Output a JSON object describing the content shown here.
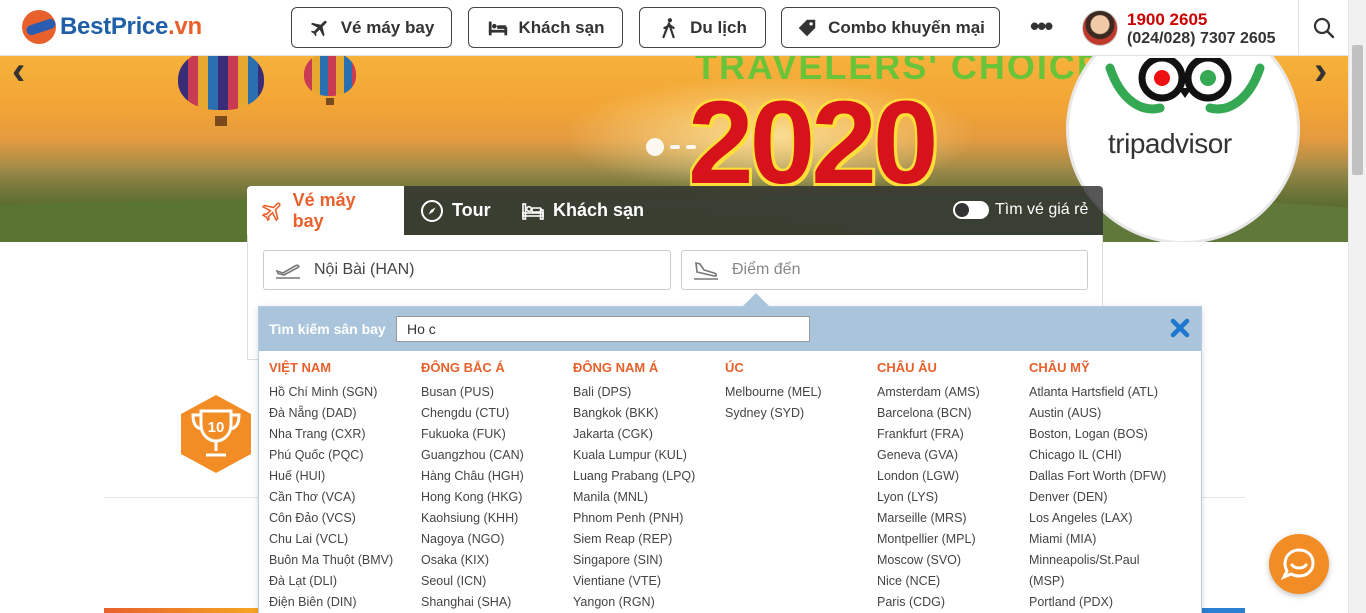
{
  "brand": {
    "name_main": "BestPrice",
    "name_tld": ".vn"
  },
  "nav": {
    "items": [
      {
        "label": "Vé máy bay",
        "icon": "plane-icon"
      },
      {
        "label": "Khách sạn",
        "icon": "bed-icon"
      },
      {
        "label": "Du lịch",
        "icon": "hiker-icon"
      },
      {
        "label": "Combo khuyến mại",
        "icon": "tag-icon"
      }
    ],
    "more": "•••"
  },
  "hotline": {
    "primary": "1900 2605",
    "secondary": "(024/028) 7307 2605"
  },
  "hero": {
    "banner_text_top": "TRAVELERS' CHOICE",
    "banner_year": "2020",
    "partner": "tripadvisor",
    "prev_arrow": "‹",
    "next_arrow": "›"
  },
  "search_widget": {
    "tabs": [
      {
        "label": "Vé máy bay",
        "active": true
      },
      {
        "label": "Tour",
        "active": false
      },
      {
        "label": "Khách sạn",
        "active": false
      }
    ],
    "cheap_toggle_label": "Tìm vé giá rẻ",
    "origin_value": "Nội Bài (HAN)",
    "destination_placeholder": "Điểm đến"
  },
  "airport_dropdown": {
    "search_label": "Tìm kiếm sân bay",
    "search_value": "Ho c",
    "regions": [
      {
        "title": "VIỆT NAM",
        "airports": [
          "Hồ Chí Minh (SGN)",
          "Đà Nẵng (DAD)",
          "Nha Trang (CXR)",
          "Phú Quốc (PQC)",
          "Huế (HUI)",
          "Cần Thơ (VCA)",
          "Côn Đảo (VCS)",
          "Chu Lai (VCL)",
          "Buôn Ma Thuột (BMV)",
          "Đà Lạt (DLI)",
          "Điện Biên (DIN)"
        ]
      },
      {
        "title": "ĐÔNG BẮC Á",
        "airports": [
          "Busan (PUS)",
          "Chengdu (CTU)",
          "Fukuoka (FUK)",
          "Guangzhou (CAN)",
          "Hàng Châu (HGH)",
          "Hong Kong (HKG)",
          "Kaohsiung (KHH)",
          "Nagoya (NGO)",
          "Osaka (KIX)",
          "Seoul (ICN)",
          "Shanghai (SHA)"
        ]
      },
      {
        "title": "ĐÔNG NAM Á",
        "airports": [
          "Bali (DPS)",
          "Bangkok (BKK)",
          "Jakarta (CGK)",
          "Kuala Lumpur (KUL)",
          "Luang Prabang (LPQ)",
          "Manila (MNL)",
          "Phnom Penh (PNH)",
          "Siem Reap (REP)",
          "Singapore (SIN)",
          "Vientiane (VTE)",
          "Yangon (RGN)"
        ]
      },
      {
        "title": "ÚC",
        "airports": [
          "Melbourne (MEL)",
          "Sydney (SYD)"
        ]
      },
      {
        "title": "CHÂU ÂU",
        "airports": [
          "Amsterdam (AMS)",
          "Barcelona (BCN)",
          "Frankfurt (FRA)",
          "Geneva (GVA)",
          "London (LGW)",
          "Lyon (LYS)",
          "Marseille (MRS)",
          "Montpellier (MPL)",
          "Moscow (SVO)",
          "Nice (NCE)",
          "Paris (CDG)"
        ]
      },
      {
        "title": "CHÂU MỸ",
        "airports": [
          "Atlanta Hartsfield (ATL)",
          "Austin (AUS)",
          "Boston, Logan (BOS)",
          "Chicago IL (CHI)",
          "Dallas Fort Worth (DFW)",
          "Denver (DEN)",
          "Los Angeles (LAX)",
          "Miami (MIA)",
          "Minneapolis/St.Paul",
          "(MSP)",
          "Portland (PDX)"
        ]
      }
    ]
  },
  "award_badge": {
    "number": "10"
  },
  "colors": {
    "accent": "#e8612c",
    "brand_blue": "#1f5fa8",
    "hotline_red": "#cc0000",
    "dropdown_head": "#a9c4db",
    "close_blue": "#1e78d2"
  }
}
